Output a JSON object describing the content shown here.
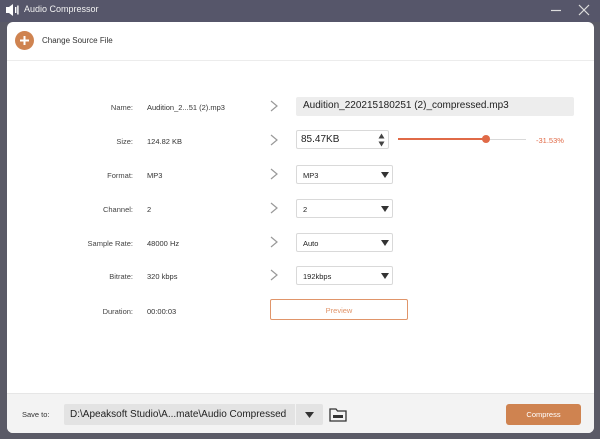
{
  "window": {
    "title": "Audio Compressor"
  },
  "toolbar": {
    "change_source_label": "Change Source File"
  },
  "fields": {
    "name": {
      "label": "Name:",
      "source": "Audition_2...51 (2).mp3",
      "output": "Audition_220215180251 (2)_compressed.mp3"
    },
    "size": {
      "label": "Size:",
      "source": "124.82 KB",
      "output": "85.47KB",
      "percent": "-31.53%",
      "slider_fraction": 0.6847
    },
    "format": {
      "label": "Format:",
      "source": "MP3",
      "output": "MP3"
    },
    "channel": {
      "label": "Channel:",
      "source": "2",
      "output": "2"
    },
    "sample_rate": {
      "label": "Sample Rate:",
      "source": "48000 Hz",
      "output": "Auto"
    },
    "bitrate": {
      "label": "Bitrate:",
      "source": "320 kbps",
      "output": "192kbps"
    },
    "duration": {
      "label": "Duration:",
      "source": "00:00:03"
    }
  },
  "preview_label": "Preview",
  "footer": {
    "save_to_label": "Save to:",
    "save_path": "D:\\Apeaksoft Studio\\A...mate\\Audio Compressed",
    "compress_label": "Compress"
  },
  "colors": {
    "accent": "#cf8350",
    "slider": "#e06a47",
    "titlebar": "#56566a"
  }
}
